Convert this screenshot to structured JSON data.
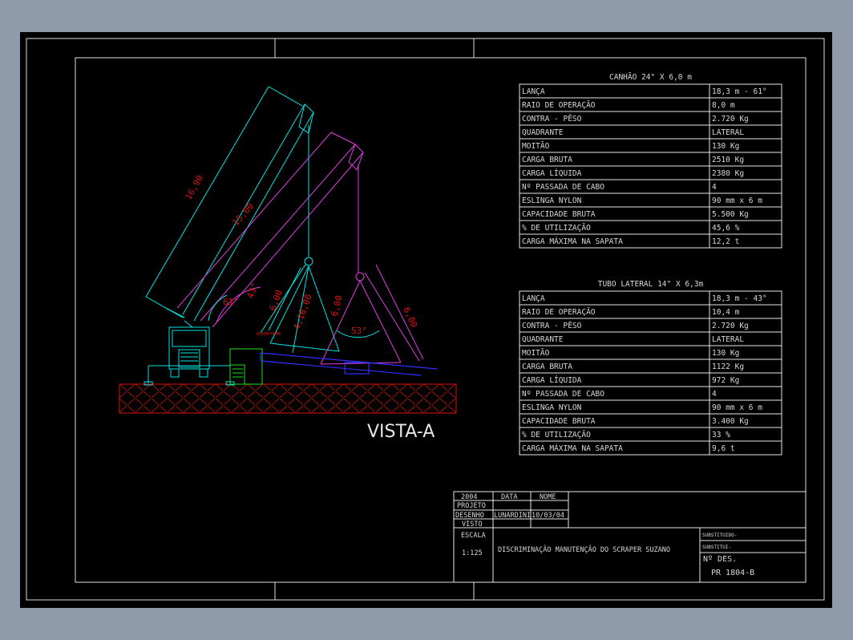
{
  "drawing": {
    "view_label": "VISTA-A",
    "dims": {
      "cyan_long": "16,90",
      "magenta_long": "15,00",
      "angle_cyan": "61°",
      "angle_magenta": "43°",
      "cyan_sling": "6,00",
      "cyan_base": "4,16,00",
      "magenta_sling": "6,00",
      "magenta_sling_right": "6,00",
      "angle_53": "53°"
    },
    "platform_label": "PLATAFORMA"
  },
  "tables": [
    {
      "title": "CANHÃO 24\" X 6,0 m",
      "rows": [
        [
          "LANÇA",
          "18,3 m - 61°"
        ],
        [
          "RAIO DE OPERAÇÃO",
          "8,0 m"
        ],
        [
          "CONTRA - PÊSO",
          "2.720 Kg"
        ],
        [
          "QUADRANTE",
          "LATERAL"
        ],
        [
          "MOITÃO",
          "130 Kg"
        ],
        [
          "CARGA BRUTA",
          "2510 Kg"
        ],
        [
          "CARGA LÍQUIDA",
          "2380 Kg"
        ],
        [
          "Nº PASSADA DE CABO",
          "4"
        ],
        [
          "ESLINGA NYLON",
          "90 mm x 6 m"
        ],
        [
          "CAPACIDADE BRUTA",
          "5.500 Kg"
        ],
        [
          "%  DE UTILIZAÇÃO",
          "45,6 %"
        ],
        [
          "CARGA MÁXIMA NA SAPATA",
          "12,2 t"
        ]
      ]
    },
    {
      "title": "TUBO LATERAL 14\" X 6,3m",
      "rows": [
        [
          "LANÇA",
          "18,3 m - 43°"
        ],
        [
          "RAIO DE OPERAÇÃO",
          "10,4 m"
        ],
        [
          "CONTRA - PÊSO",
          "2.720 Kg"
        ],
        [
          "QUADRANTE",
          "LATERAL"
        ],
        [
          "MOITÃO",
          "130 Kg"
        ],
        [
          "CARGA BRUTA",
          "1122 Kg"
        ],
        [
          "CARGA LÍQUIDA",
          "972 Kg"
        ],
        [
          "Nº PASSADA DE CABO",
          "4"
        ],
        [
          "ESLINGA NYLON",
          "90 mm x 6 m"
        ],
        [
          "CAPACIDADE BRUTA",
          "3.400 Kg"
        ],
        [
          "%  DE UTILIZAÇÃO",
          "33 %"
        ],
        [
          "CARGA MÁXIMA NA SAPATA",
          "9,6 t"
        ]
      ]
    }
  ],
  "title_block": {
    "year": "2004",
    "data_header": "DATA",
    "nome_header": "NOME",
    "projeto": "PROJETO",
    "desenho": "DESENHO",
    "designer": "LUNARDINI",
    "date": "10/03/04",
    "visto": "VISTO",
    "escala_label": "ESCALA",
    "escala_value": "1:125",
    "description": "DISCRIMINAÇÃO MANUTENÇÃO DO SCRAPER SUZANO",
    "substituido": "SUBSTITUIDO-",
    "substitui": "SUBSTITUI-",
    "drawing_no_label": "Nº DES.",
    "drawing_no": "PR 1804-B"
  },
  "colors": {
    "background": "#000000",
    "border": "#ffffff",
    "cyan": "#00e5e5",
    "magenta": "#e040e0",
    "red": "#e01010",
    "green": "#20e020",
    "blue": "#3030ff"
  }
}
